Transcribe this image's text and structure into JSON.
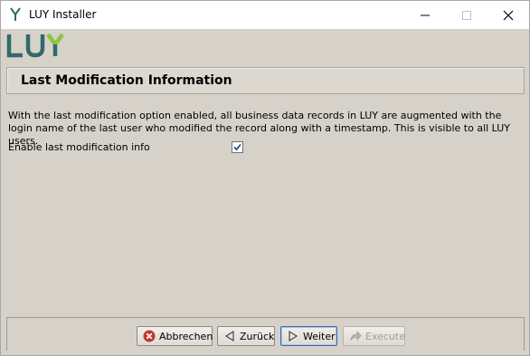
{
  "window": {
    "title": "LUY Installer",
    "controls": [
      "minimize-icon",
      "maximize-icon",
      "close-icon"
    ]
  },
  "brand": {
    "logo_text": "LUY",
    "color": "#2f6b6a",
    "accent": "#8cc63f"
  },
  "header": {
    "title": "Last Modification Information"
  },
  "content": {
    "description": "With the last modification option enabled, all business data records in LUY are augmented with the login name of the last user who modified the record along with a timestamp. This is visible to all LUY users.",
    "option_label": "Enable last modification info",
    "option_checked": true
  },
  "footer": {
    "buttons": {
      "abbrechen": "Abbrechen",
      "zurueck": "Zurück",
      "weiter": "Weiter",
      "execute": "Execute"
    }
  },
  "colors": {
    "background": "#d6d2ca",
    "error_red": "#c0392b",
    "focus_blue": "#3c6bb0"
  }
}
